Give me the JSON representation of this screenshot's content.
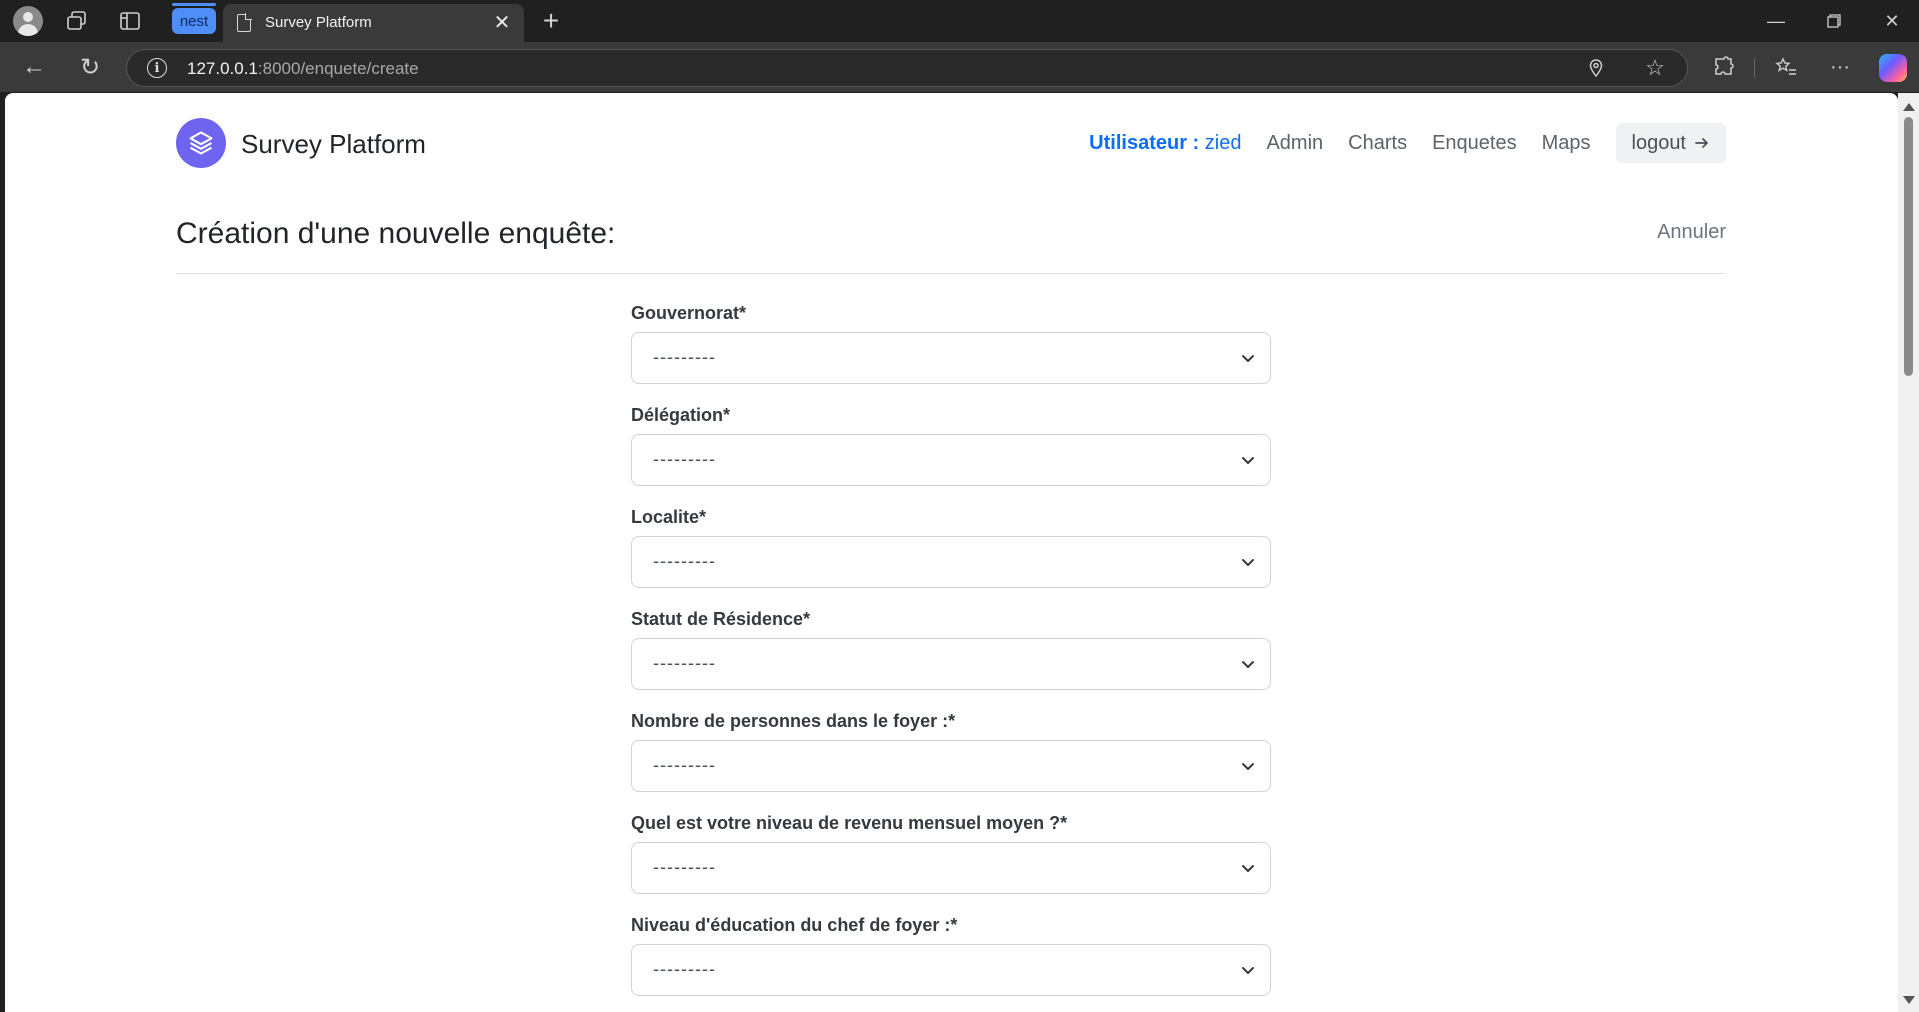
{
  "browser": {
    "tab_group_label": "nest",
    "tab_title": "Survey Platform",
    "url_host": "127.0.0.1",
    "url_rest": ":8000/enquete/create"
  },
  "header": {
    "brand": "Survey Platform",
    "user_label": "Utilisateur :",
    "user_name": "zied",
    "nav": [
      "Admin",
      "Charts",
      "Enquetes",
      "Maps"
    ],
    "logout_label": "logout",
    "logout_icon": "arrow-right-icon",
    "logo_icon": "layers-icon",
    "accent_color": "#0d6efd",
    "logo_color": "#6f64f0"
  },
  "page": {
    "title": "Création d'une nouvelle enquête:",
    "cancel_label": "Annuler"
  },
  "form": {
    "fields": [
      {
        "label": "Gouvernorat*",
        "value": "---------"
      },
      {
        "label": "Délégation*",
        "value": "---------"
      },
      {
        "label": "Localite*",
        "value": "---------"
      },
      {
        "label": "Statut de Résidence*",
        "value": "---------"
      },
      {
        "label": "Nombre de personnes dans le foyer :*",
        "value": "---------"
      },
      {
        "label": "Quel est votre niveau de revenu mensuel moyen ?*",
        "value": "---------"
      },
      {
        "label": "Niveau d'éducation du chef de foyer :*",
        "value": "---------"
      }
    ]
  }
}
